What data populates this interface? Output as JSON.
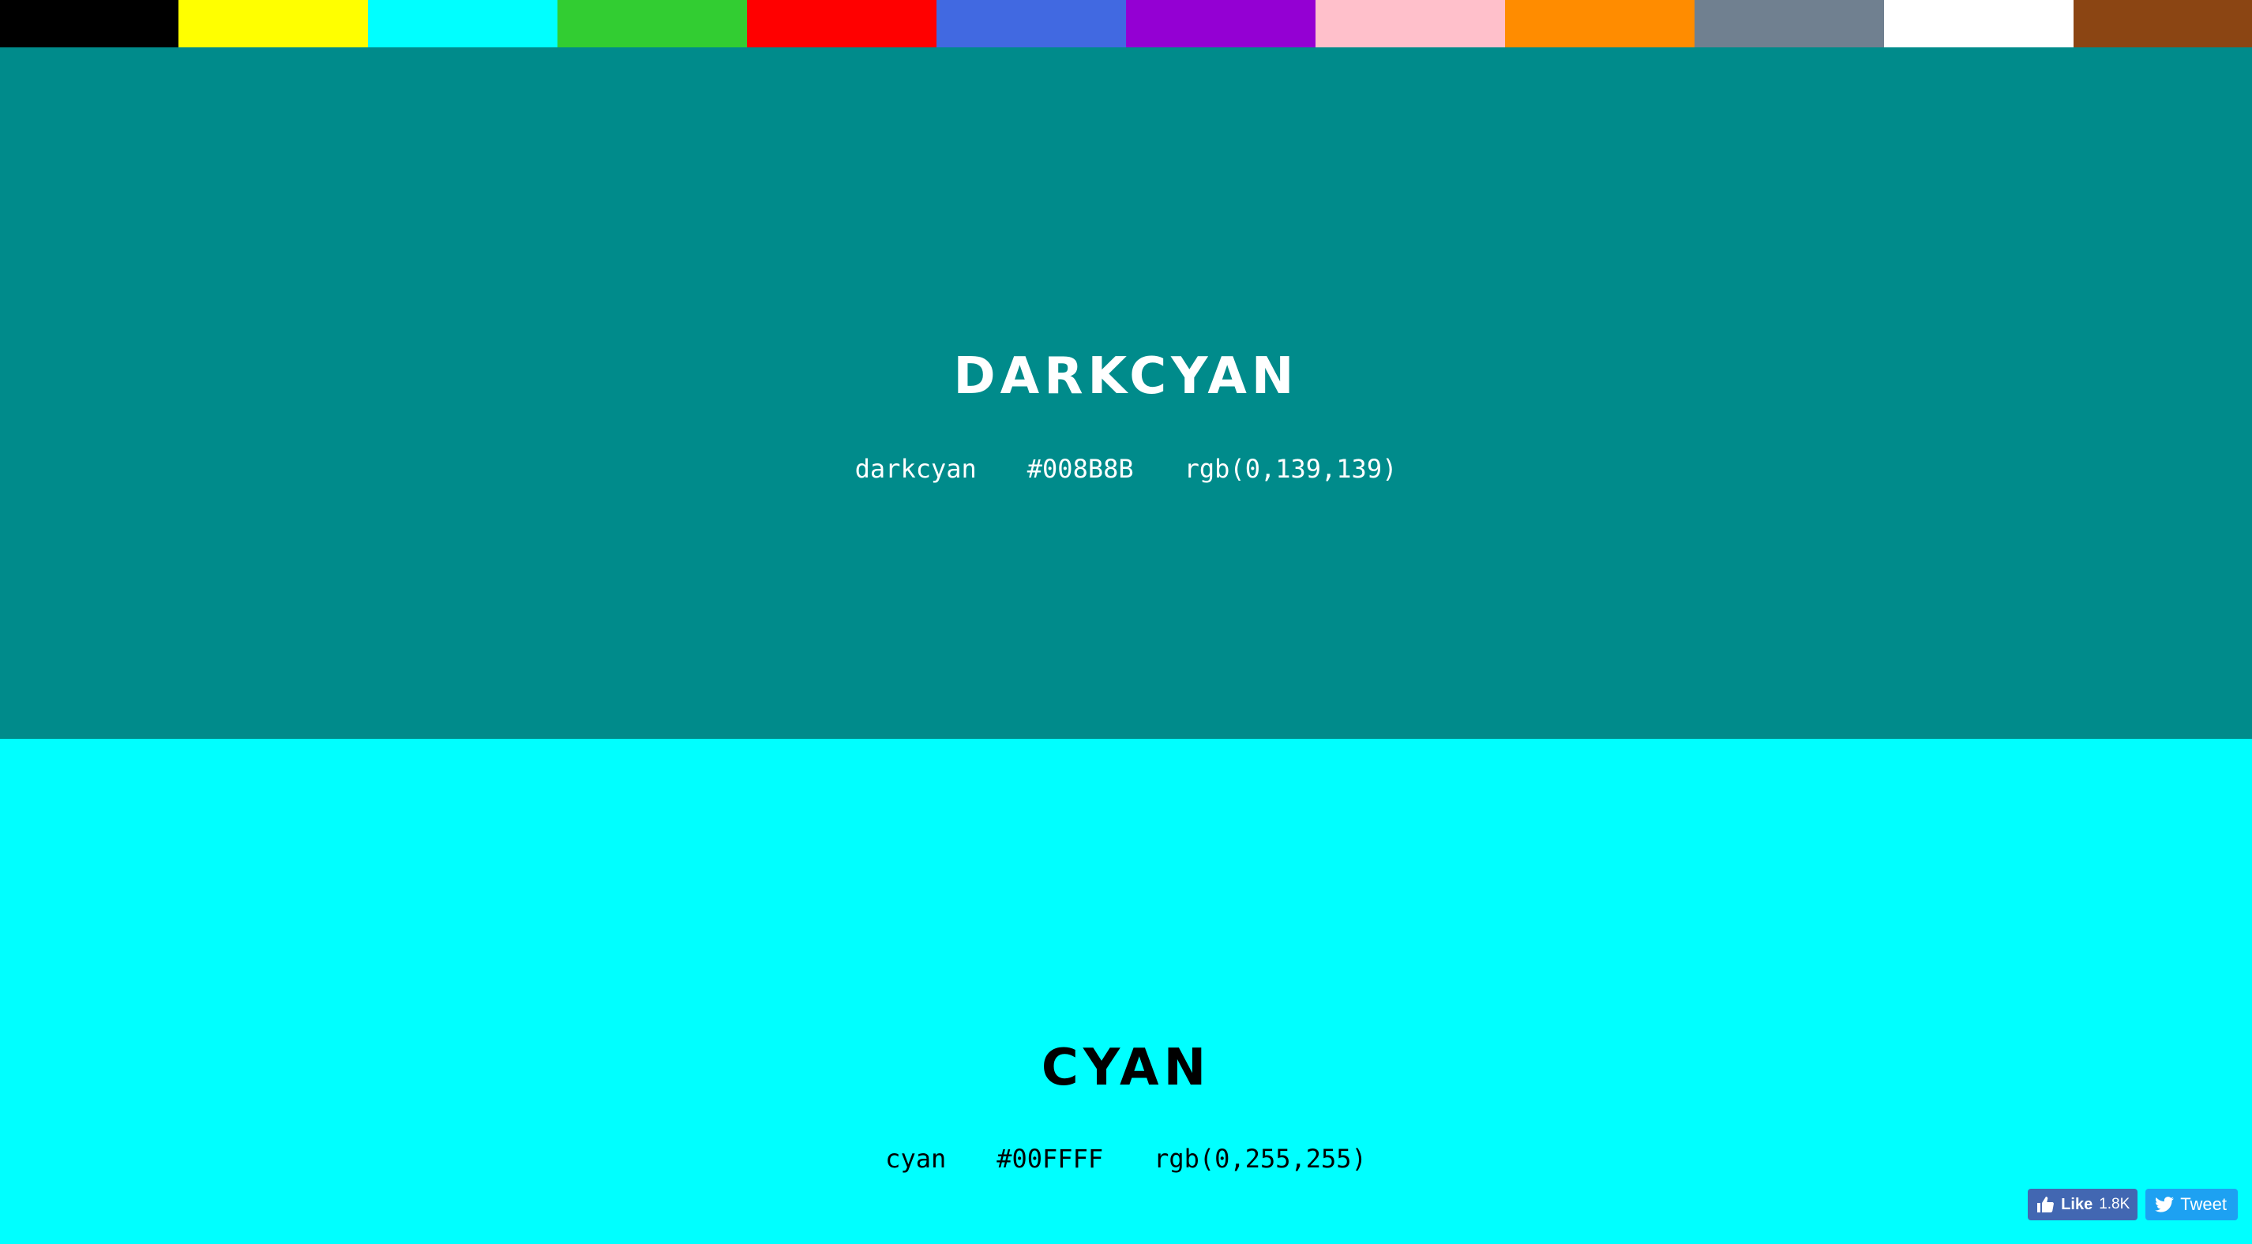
{
  "swatches": [
    {
      "name": "black",
      "color": "#000000"
    },
    {
      "name": "yellow",
      "color": "#FFFF00"
    },
    {
      "name": "cyan",
      "color": "#00FFFF"
    },
    {
      "name": "limegreen",
      "color": "#32CD32"
    },
    {
      "name": "red",
      "color": "#FF0000"
    },
    {
      "name": "royalblue",
      "color": "#4169E1"
    },
    {
      "name": "darkviolet",
      "color": "#9400D3"
    },
    {
      "name": "pink",
      "color": "#FFC0CB"
    },
    {
      "name": "darkorange",
      "color": "#FF8C00"
    },
    {
      "name": "slategray",
      "color": "#708090"
    },
    {
      "name": "white",
      "color": "#FFFFFF"
    },
    {
      "name": "saddlebrown",
      "color": "#8B4513"
    }
  ],
  "panels": [
    {
      "title": "DARKCYAN",
      "name": "darkcyan",
      "hex": "#008B8B",
      "rgb": "rgb(0,139,139)",
      "background": "#008B8B",
      "text_color": "#FFFFFF"
    },
    {
      "title": "CYAN",
      "name": "cyan",
      "hex": "#00FFFF",
      "rgb": "rgb(0,255,255)",
      "background": "#00FFFF",
      "text_color": "#000000"
    }
  ],
  "social": {
    "like_label": "Like",
    "like_count": "1.8K",
    "tweet_label": "Tweet",
    "like_icon": "thumbs-up-icon",
    "tweet_icon": "twitter-bird-icon"
  }
}
